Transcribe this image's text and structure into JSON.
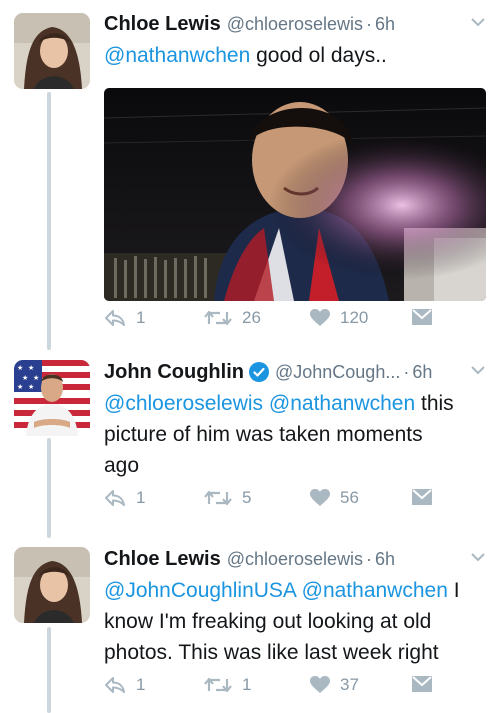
{
  "tweets": [
    {
      "name": "Chloe Lewis",
      "handle": "@chloeroselewis",
      "dot": "·",
      "time": "6h",
      "text_parts": [
        "@nathanwchen",
        " good ol days.."
      ],
      "replies": "1",
      "retweets": "26",
      "likes": "120",
      "has_media": true
    },
    {
      "name": "John Coughlin",
      "verified": true,
      "handle": "@JohnCough...",
      "dot": "·",
      "time": "6h",
      "line1_parts": [
        "@chloeroselewis",
        " ",
        "@nathanwchen",
        " this"
      ],
      "line2": "picture of him was taken moments",
      "line3": "ago",
      "replies": "1",
      "retweets": "5",
      "likes": "56"
    },
    {
      "name": "Chloe Lewis",
      "handle": "@chloeroselewis",
      "dot": "·",
      "time": "6h",
      "line1_parts": [
        "@JohnCoughlinUSA",
        " ",
        "@nathanwchen",
        " I"
      ],
      "line2": "know I'm freaking out looking at old",
      "line3": "photos. This was like last week right",
      "replies": "1",
      "retweets": "1",
      "likes": "37"
    }
  ],
  "colors": {
    "link": "#1b95e0",
    "muted": "#657786",
    "action": "#8899a6",
    "thread_line": "#ccd6dd"
  },
  "icons": [
    "reply-icon",
    "retweet-icon",
    "like-icon",
    "dm-icon",
    "chevron-down-icon",
    "verified-icon"
  ]
}
